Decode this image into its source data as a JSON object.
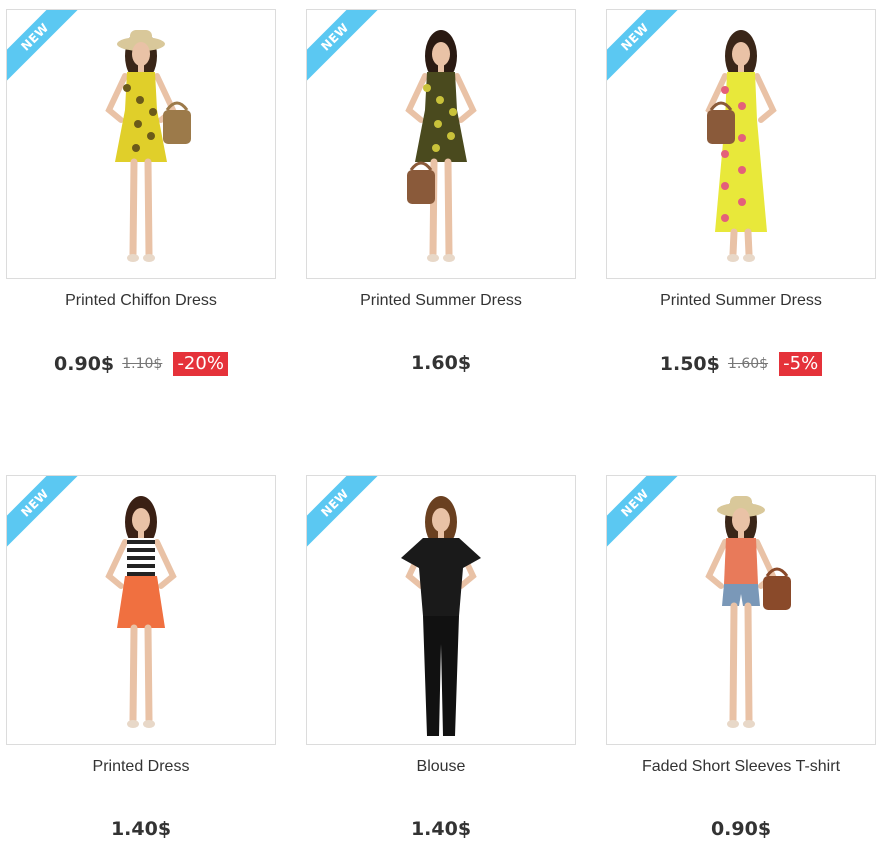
{
  "products": [
    {
      "name": "Printed Chiffon Dress",
      "badge": "NEW",
      "price": "0.90$",
      "old_price": "1.10$",
      "discount": "-20%",
      "colors": {
        "dress": "#e0cf2a",
        "accent": "#6b5a1a",
        "bag": "#9c7a4a",
        "hair": "#3a2618"
      }
    },
    {
      "name": "Printed Summer Dress",
      "badge": "NEW",
      "price": "1.60$",
      "old_price": "",
      "discount": "",
      "colors": {
        "dress": "#4a4a1e",
        "accent": "#c9c23a",
        "bag": "#8a5a3a",
        "hair": "#2a1a12"
      }
    },
    {
      "name": "Printed Summer Dress",
      "badge": "NEW",
      "price": "1.50$",
      "old_price": "1.60$",
      "discount": "-5%",
      "colors": {
        "dress": "#e8e83a",
        "accent": "#e4607a",
        "bag": "#8a5a3a",
        "hair": "#3a2618"
      }
    },
    {
      "name": "Printed Dress",
      "badge": "NEW",
      "price": "1.40$",
      "old_price": "",
      "discount": "",
      "colors": {
        "dress": "#f07040",
        "accent": "#222222",
        "bag": "",
        "hair": "#3a2014"
      }
    },
    {
      "name": "Blouse",
      "badge": "NEW",
      "price": "1.40$",
      "old_price": "",
      "discount": "",
      "colors": {
        "dress": "#1a1a1a",
        "accent": "#1a1a1a",
        "bag": "",
        "hair": "#6a4020"
      }
    },
    {
      "name": "Faded Short Sleeves T-shirt",
      "badge": "NEW",
      "price": "0.90$",
      "old_price": "",
      "discount": "",
      "colors": {
        "dress": "#e87a5a",
        "accent": "#7a98b8",
        "bag": "#8a4a2a",
        "hair": "#3a2618"
      }
    }
  ]
}
